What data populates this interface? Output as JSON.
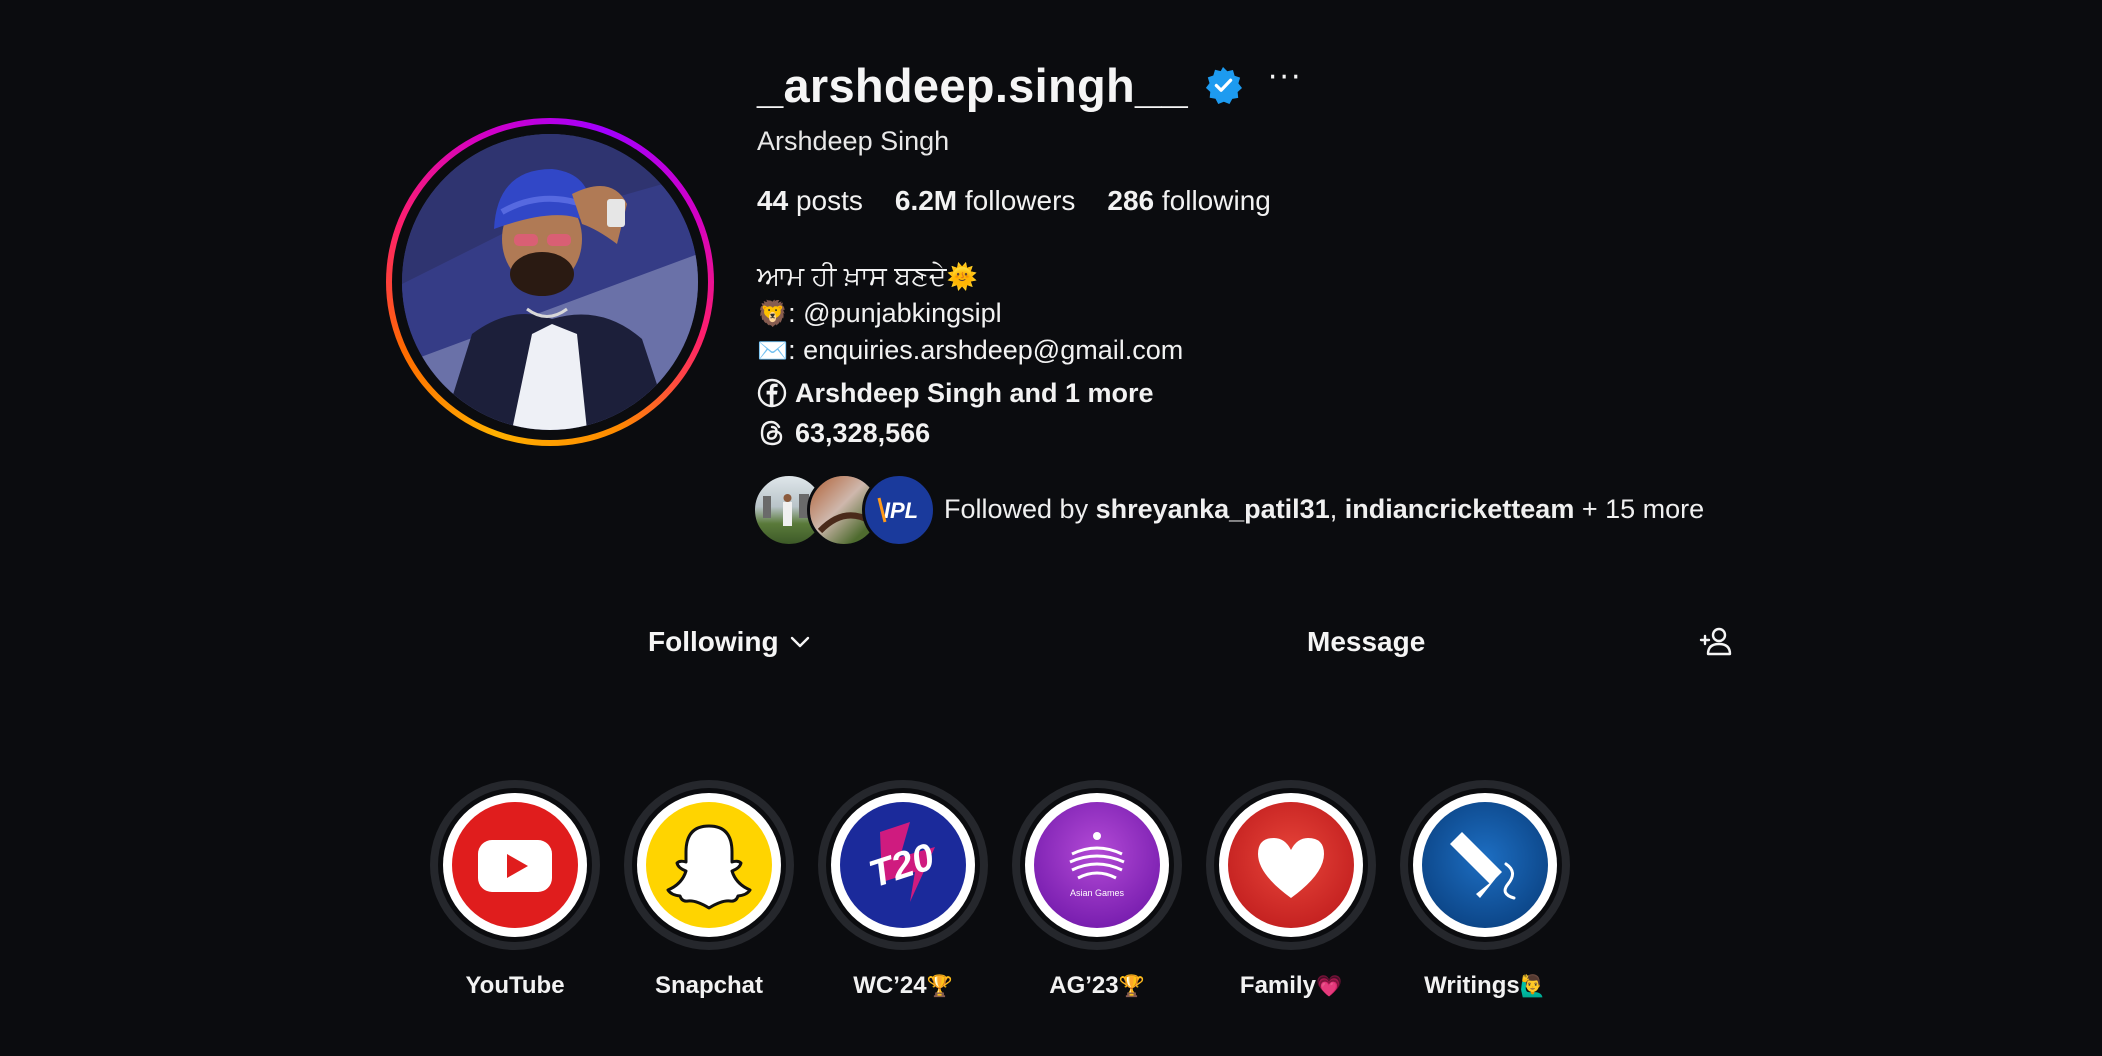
{
  "profile": {
    "username": "_arshdeep.singh__",
    "more_label": "···",
    "full_name": "Arshdeep Singh",
    "stats": {
      "posts_count": "44",
      "posts_label": "posts",
      "followers_count": "6.2M",
      "followers_label": "followers",
      "following_count": "286",
      "following_label": "following"
    },
    "bio": {
      "line1": "ਆਮ ਹੀ ਖ਼ਾਸ ਬਣਦੇ",
      "line1_emoji": "🌞",
      "line2_emoji": "🦁",
      "line2": ": @punjabkingsipl",
      "line3_emoji": "✉️",
      "line3": ": enquiries.arshdeep@gmail.com",
      "facebook_link": "Arshdeep Singh and 1 more",
      "threads_count": "63,328,566"
    },
    "followed_by": {
      "prefix": "Followed by ",
      "user1": "shreyanka_patil31",
      "separator": ", ",
      "user2": "indiancricketteam",
      "suffix": " + 15 more"
    },
    "buttons": {
      "following": "Following",
      "message": "Message"
    }
  },
  "highlights": [
    {
      "label": "YouTube",
      "emoji": ""
    },
    {
      "label": "Snapchat",
      "emoji": ""
    },
    {
      "label": "WC’24",
      "emoji": "🏆"
    },
    {
      "label": "AG’23",
      "emoji": "🏆"
    },
    {
      "label": "Family",
      "emoji": "💗"
    },
    {
      "label": "Writings",
      "emoji": "🙋‍♂️"
    }
  ],
  "highlight_covers": {
    "wc_text": "T20",
    "ag_text": "Asian Games",
    "ipl_text": "IPL"
  },
  "colors": {
    "background": "#0b0c0f",
    "verified": "#1d9bf0",
    "youtube": "#e01d1d",
    "snapchat": "#ffd400",
    "wc": "#1b2a9b",
    "ag": "#8a2be2",
    "family": "#d9312b",
    "writings": "#0e4f9c"
  }
}
